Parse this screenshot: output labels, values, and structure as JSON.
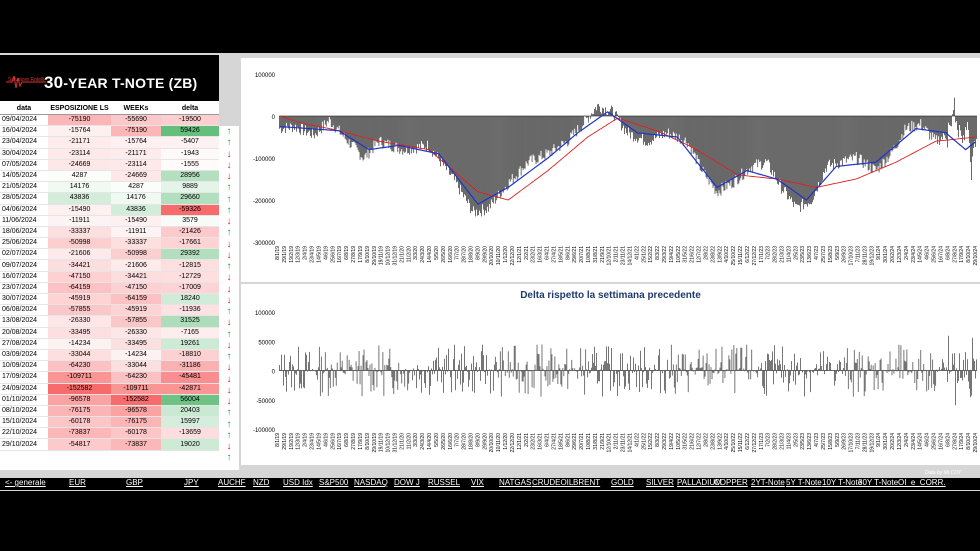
{
  "title": {
    "prefix": "30",
    "rest": "-YEAR T-NOTE (ZB)",
    "logo_text": "Salvatore Rotelli"
  },
  "table": {
    "headers": [
      "data",
      "ESPOSIZIONE LS",
      "WEEKs",
      "delta"
    ],
    "rows": [
      {
        "d": "09/04/2024",
        "e": "-75190",
        "w": "-55690",
        "dl": "-19500",
        "a": "up"
      },
      {
        "d": "16/04/2024",
        "e": "-15764",
        "w": "-75190",
        "dl": "59426",
        "a": "up"
      },
      {
        "d": "23/04/2024",
        "e": "-21171",
        "w": "-15764",
        "dl": "-5407",
        "a": "down"
      },
      {
        "d": "30/04/2024",
        "e": "-23114",
        "w": "-21171",
        "dl": "-1943",
        "a": "down"
      },
      {
        "d": "07/05/2024",
        "e": "-24669",
        "w": "-23114",
        "dl": "-1555",
        "a": "down"
      },
      {
        "d": "14/05/2024",
        "e": "4287",
        "w": "-24669",
        "dl": "28956",
        "a": "up"
      },
      {
        "d": "21/05/2024",
        "e": "14176",
        "w": "4287",
        "dl": "9889",
        "a": "up"
      },
      {
        "d": "28/05/2024",
        "e": "43836",
        "w": "14176",
        "dl": "29660",
        "a": "up"
      },
      {
        "d": "04/06/2024",
        "e": "-15490",
        "w": "43836",
        "dl": "-59326",
        "a": "down"
      },
      {
        "d": "11/06/2024",
        "e": "-11911",
        "w": "-15490",
        "dl": "3579",
        "a": "up"
      },
      {
        "d": "18/06/2024",
        "e": "-33337",
        "w": "-11911",
        "dl": "-21426",
        "a": "down"
      },
      {
        "d": "25/06/2024",
        "e": "-50998",
        "w": "-33337",
        "dl": "-17661",
        "a": "down"
      },
      {
        "d": "02/07/2024",
        "e": "-21606",
        "w": "-50998",
        "dl": "29392",
        "a": "up"
      },
      {
        "d": "09/07/2024",
        "e": "-34421",
        "w": "-21606",
        "dl": "-12815",
        "a": "down"
      },
      {
        "d": "16/07/2024",
        "e": "-47150",
        "w": "-34421",
        "dl": "-12729",
        "a": "down"
      },
      {
        "d": "23/07/2024",
        "e": "-64159",
        "w": "-47150",
        "dl": "-17009",
        "a": "down"
      },
      {
        "d": "30/07/2024",
        "e": "-45919",
        "w": "-64159",
        "dl": "18240",
        "a": "up"
      },
      {
        "d": "06/08/2024",
        "e": "-57855",
        "w": "-45919",
        "dl": "-11936",
        "a": "down"
      },
      {
        "d": "13/08/2024",
        "e": "-26330",
        "w": "-57855",
        "dl": "31525",
        "a": "up"
      },
      {
        "d": "20/08/2024",
        "e": "-33495",
        "w": "-26330",
        "dl": "-7165",
        "a": "down"
      },
      {
        "d": "27/08/2024",
        "e": "-14234",
        "w": "-33495",
        "dl": "19261",
        "a": "up"
      },
      {
        "d": "03/09/2024",
        "e": "-33044",
        "w": "-14234",
        "dl": "-18810",
        "a": "down"
      },
      {
        "d": "10/09/2024",
        "e": "-64230",
        "w": "-33044",
        "dl": "-31186",
        "a": "down"
      },
      {
        "d": "17/09/2024",
        "e": "-109711",
        "w": "-64230",
        "dl": "-45481",
        "a": "down"
      },
      {
        "d": "24/09/2024",
        "e": "-152582",
        "w": "-109711",
        "dl": "-42871",
        "a": "down"
      },
      {
        "d": "01/10/2024",
        "e": "-96578",
        "w": "-152582",
        "dl": "56004",
        "a": "up"
      },
      {
        "d": "08/10/2024",
        "e": "-76175",
        "w": "-96578",
        "dl": "20403",
        "a": "up"
      },
      {
        "d": "15/10/2024",
        "e": "-60178",
        "w": "-76175",
        "dl": "15997",
        "a": "up"
      },
      {
        "d": "22/10/2024",
        "e": "-73837",
        "w": "-60178",
        "dl": "-13659",
        "a": "down"
      },
      {
        "d": "29/10/2024",
        "e": "-54817",
        "w": "-73837",
        "dl": "19020",
        "a": "up"
      }
    ]
  },
  "colors": {
    "pos_strong": "#63be7b",
    "neg_strong": "#f8696b",
    "bar": "#1a1a1a",
    "ma_fast": "#1f35c8",
    "ma_slow": "#e02020",
    "arrow_up": "#21a336",
    "arrow_down": "#d62020"
  },
  "nav": [
    "<- generale",
    "EUR",
    "GBP",
    "JPY",
    "AUCHF",
    "NZD",
    "USD Idx",
    "S&P500",
    "NASDAQ",
    "DOW J",
    "RUSSEL",
    "VIX",
    "NATGAS",
    "CRUDEOIL",
    "BRENT",
    "GOLD",
    "SILVER",
    "PALLADIUM",
    "COPPER",
    "2YT-Note",
    "5Y T-Note",
    "10Y T-Note",
    "30Y T-Note",
    "OI_e_CORR."
  ],
  "credit": "Data by Mr.COT",
  "chart_data": [
    {
      "type": "bar",
      "title": "",
      "ylim": [
        -300000,
        100000
      ],
      "yticks": [
        100000,
        0,
        -100000,
        -200000,
        -300000
      ],
      "xticks": [
        "8/1/19",
        "29/1/19",
        "19/2/19",
        "12/3/19",
        "2/4/19",
        "23/4/19",
        "14/5/19",
        "4/6/19",
        "25/6/19",
        "16/7/19",
        "6/8/19",
        "27/8/19",
        "17/9/19",
        "8/10/19",
        "29/10/19",
        "19/11/19",
        "10/12/19",
        "31/12/19",
        "21/1/20",
        "11/2/20",
        "3/3/20",
        "24/3/20",
        "14/4/20",
        "5/5/20",
        "26/5/20",
        "16/6/20",
        "7/7/20",
        "28/7/20",
        "18/8/20",
        "8/9/20",
        "29/9/20",
        "20/10/20",
        "10/11/20",
        "1/12/20",
        "22/12/20",
        "12/1/21",
        "2/2/21",
        "23/2/21",
        "16/3/21",
        "6/4/21",
        "27/4/21",
        "18/5/21",
        "8/6/21",
        "29/6/21",
        "20/7/21",
        "10/8/21",
        "31/8/21",
        "21/9/21",
        "12/10/21",
        "2/11/21",
        "23/11/21",
        "14/12/21",
        "4/1/22",
        "25/1/22",
        "15/2/22",
        "8/3/22",
        "29/3/22",
        "19/4/22",
        "10/5/22",
        "31/5/22",
        "21/6/22",
        "12/7/22",
        "2/8/22",
        "23/8/22",
        "13/9/22",
        "4/10/22",
        "25/10/22",
        "15/11/22",
        "6/12/22",
        "27/12/22",
        "17/1/23",
        "7/2/23",
        "28/2/23",
        "21/3/23",
        "11/4/23",
        "2/5/23",
        "23/5/23",
        "13/6/23",
        "4/7/23",
        "25/7/23",
        "15/8/23",
        "5/9/23",
        "26/9/23",
        "17/10/23",
        "7/11/23",
        "28/11/23",
        "19/12/23",
        "9/1/24",
        "30/1/24",
        "20/2/24",
        "12/3/24",
        "2/4/24",
        "23/4/24",
        "14/5/24",
        "4/6/24",
        "25/6/24",
        "16/7/24",
        "6/8/24",
        "27/8/24",
        "17/9/24",
        "8/10/24",
        "29/10/24"
      ],
      "anchors": [
        [
          0,
          -30000
        ],
        [
          15,
          -25000
        ],
        [
          35,
          -45000
        ],
        [
          50,
          -10000
        ],
        [
          65,
          -50000
        ],
        [
          85,
          -100000
        ],
        [
          100,
          -60000
        ],
        [
          125,
          -80000
        ],
        [
          150,
          -70000
        ],
        [
          175,
          -150000
        ],
        [
          195,
          -230000
        ],
        [
          210,
          -220000
        ],
        [
          230,
          -160000
        ],
        [
          250,
          -110000
        ],
        [
          270,
          -90000
        ],
        [
          290,
          -60000
        ],
        [
          305,
          -20000
        ],
        [
          320,
          25000
        ],
        [
          335,
          10000
        ],
        [
          350,
          -40000
        ],
        [
          370,
          -60000
        ],
        [
          390,
          -40000
        ],
        [
          410,
          -60000
        ],
        [
          425,
          -130000
        ],
        [
          440,
          -180000
        ],
        [
          455,
          -160000
        ],
        [
          475,
          -120000
        ],
        [
          490,
          -110000
        ],
        [
          505,
          -170000
        ],
        [
          520,
          -220000
        ],
        [
          535,
          -200000
        ],
        [
          550,
          -120000
        ],
        [
          565,
          -110000
        ],
        [
          580,
          -100000
        ],
        [
          600,
          -130000
        ],
        [
          615,
          -90000
        ],
        [
          630,
          -30000
        ],
        [
          645,
          -20000
        ],
        [
          660,
          -60000
        ],
        [
          675,
          -40000
        ],
        [
          690,
          -80000
        ],
        [
          701,
          -55000
        ]
      ],
      "ma_fast_anchors": [
        [
          0,
          -25000
        ],
        [
          30,
          -30000
        ],
        [
          60,
          -35000
        ],
        [
          90,
          -80000
        ],
        [
          120,
          -70000
        ],
        [
          160,
          -90000
        ],
        [
          200,
          -210000
        ],
        [
          230,
          -170000
        ],
        [
          270,
          -100000
        ],
        [
          300,
          -40000
        ],
        [
          330,
          10000
        ],
        [
          360,
          -40000
        ],
        [
          400,
          -50000
        ],
        [
          440,
          -170000
        ],
        [
          470,
          -130000
        ],
        [
          500,
          -150000
        ],
        [
          530,
          -200000
        ],
        [
          560,
          -120000
        ],
        [
          600,
          -110000
        ],
        [
          640,
          -30000
        ],
        [
          670,
          -40000
        ],
        [
          690,
          -80000
        ],
        [
          701,
          -60000
        ]
      ],
      "ma_slow_anchors": [
        [
          0,
          0
        ],
        [
          20,
          -15000
        ],
        [
          60,
          -35000
        ],
        [
          100,
          -60000
        ],
        [
          150,
          -80000
        ],
        [
          200,
          -180000
        ],
        [
          230,
          -200000
        ],
        [
          270,
          -130000
        ],
        [
          310,
          -50000
        ],
        [
          340,
          -5000
        ],
        [
          380,
          -35000
        ],
        [
          420,
          -80000
        ],
        [
          460,
          -140000
        ],
        [
          500,
          -150000
        ],
        [
          540,
          -170000
        ],
        [
          580,
          -150000
        ],
        [
          620,
          -110000
        ],
        [
          660,
          -60000
        ],
        [
          701,
          -50000
        ]
      ]
    },
    {
      "type": "bar",
      "title": "Delta rispetto la settimana precedente",
      "ylim": [
        -100000,
        100000
      ],
      "yticks": [
        100000,
        50000,
        0,
        -50000,
        -100000
      ]
    }
  ]
}
